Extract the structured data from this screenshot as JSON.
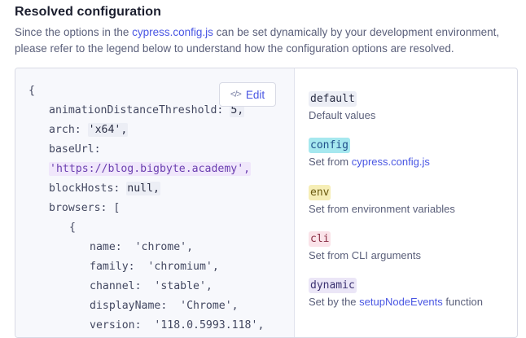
{
  "header": {
    "title": "Resolved configuration",
    "desc_before": "Since the options in the ",
    "desc_link": "cypress.config.js",
    "desc_after": " can be set dynamically by your development environment, please refer to the legend below to understand how the configuration options are resolved."
  },
  "code": {
    "open_brace": "{",
    "lines": [
      {
        "key": "animationDistanceThreshold: ",
        "value": "5,"
      },
      {
        "key": "arch: ",
        "value": "'x64',"
      },
      {
        "key": "baseUrl:",
        "value": ""
      },
      {
        "key": "",
        "value": "'https://blog.bigbyte.academy',"
      },
      {
        "key": "blockHosts: ",
        "value": "null,"
      },
      {
        "key": "browsers: [",
        "value": ""
      },
      {
        "key": "{",
        "value": ""
      },
      {
        "key": "name:  ",
        "value": "'chrome',"
      },
      {
        "key": "family:  ",
        "value": "'chromium',"
      },
      {
        "key": "channel:  ",
        "value": "'stable',"
      },
      {
        "key": "displayName:  ",
        "value": "'Chrome',"
      },
      {
        "key": "version:  ",
        "value": "'118.0.5993.118',"
      }
    ]
  },
  "edit_button": {
    "label": "Edit",
    "icon": "code-icon"
  },
  "legend": {
    "items": [
      {
        "tag": "default",
        "desc": "Default values",
        "link": "",
        "after": "",
        "color": "#eceef5"
      },
      {
        "tag": "config",
        "desc": "Set from ",
        "link": "cypress.config.js",
        "after": "",
        "color": "#a6e8ef"
      },
      {
        "tag": "env",
        "desc": "Set from environment variables",
        "link": "",
        "after": "",
        "color": "#f6eeb6"
      },
      {
        "tag": "cli",
        "desc": "Set from CLI arguments",
        "link": "",
        "after": "",
        "color": "#fae3e9"
      },
      {
        "tag": "dynamic",
        "desc": "Set by the ",
        "link": "setupNodeEvents",
        "after": " function",
        "color": "#ebe6f7"
      }
    ]
  }
}
